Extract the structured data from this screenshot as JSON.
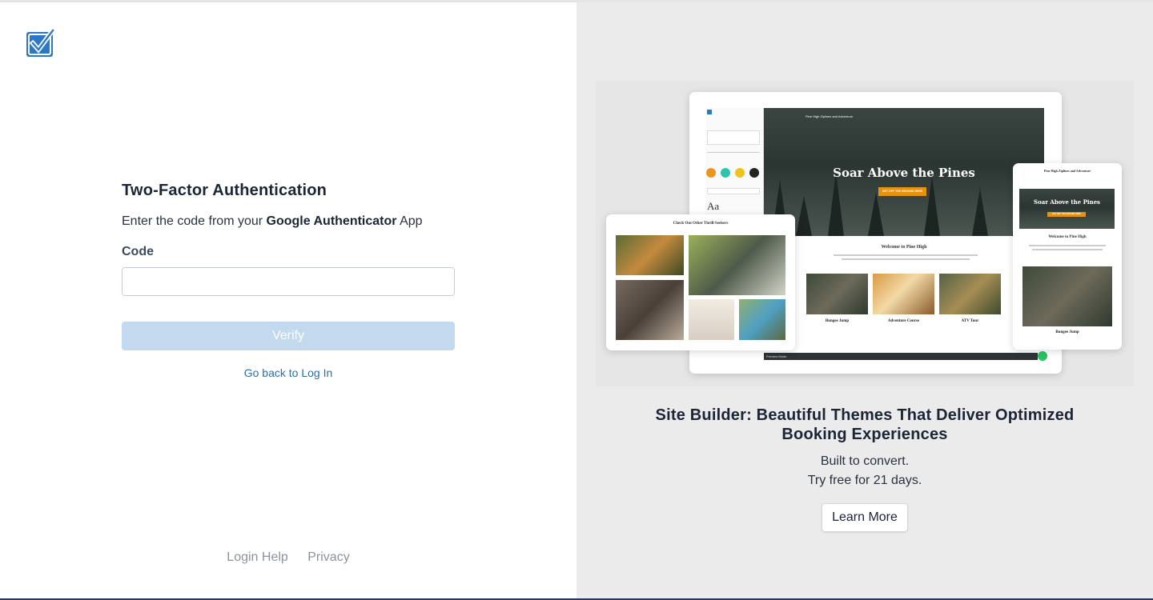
{
  "logo": {
    "icon": "checkbox-check-icon",
    "color": "#2b78c4"
  },
  "auth": {
    "title": "Two-Factor Authentication",
    "subtitle_before": "Enter the code from your ",
    "subtitle_app": "Google Authenticator",
    "subtitle_after": " App",
    "code_label": "Code",
    "code_value": "",
    "verify_label": "Verify",
    "back_link": "Go back to Log In"
  },
  "footer": {
    "help": "Login Help",
    "privacy": "Privacy"
  },
  "promo": {
    "title": "Site Builder: Beautiful Themes That Deliver Optimized Booking Experiences",
    "line1": "Built to convert.",
    "line2": "Try free for 21 days.",
    "button": "Learn More"
  },
  "mockup": {
    "site_name": "Pine High Ziplines and Adventure",
    "hero_heading": "Soar Above the Pines",
    "hero_button": "GET OFF THE GROUND HERE",
    "welcome": "Welcome to Pine High",
    "tablet_heading": "Check Out Other Thrill-Seekers",
    "activities": [
      "Bungee Jump",
      "Adventure Course",
      "ATV Tour"
    ],
    "preview_mode": "Preview Mode",
    "swatches": [
      "#e8961c",
      "#2ec4b0",
      "#f2c21b",
      "#222222"
    ],
    "editor_aa": "Aa"
  }
}
